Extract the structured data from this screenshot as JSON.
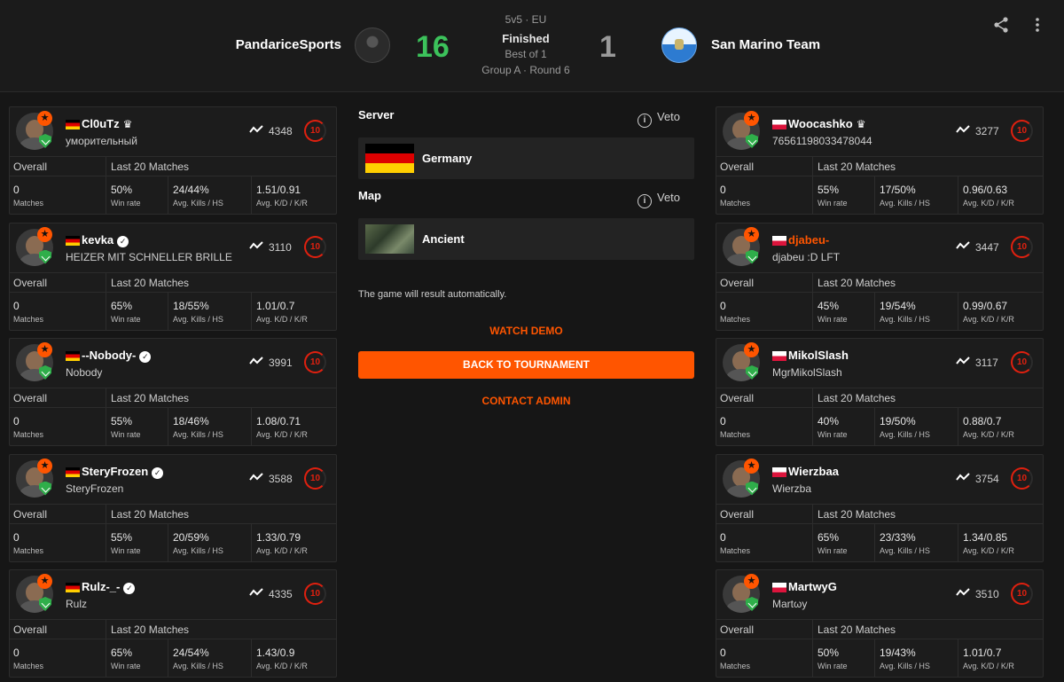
{
  "header": {
    "format": "5v5 · EU",
    "status": "Finished",
    "best_of": "Best of 1",
    "group": "Group A · Round 6",
    "team_left": {
      "name": "PandariceSports",
      "score": "16"
    },
    "team_right": {
      "name": "San Marino Team",
      "score": "1"
    },
    "icons": {
      "share": "share-icon",
      "more": "more-vertical-icon"
    }
  },
  "stat_labels": {
    "overall": "Overall",
    "last20": "Last 20 Matches",
    "matches": "Matches",
    "win_rate": "Win rate",
    "kills_hs": "Avg. Kills / HS",
    "kd_kr": "Avg. K/D / K/R"
  },
  "left_players": [
    {
      "nick": "Cl0uTz",
      "sub": "уморительный",
      "flag": "de",
      "elo": "4348",
      "level": "10",
      "badge": "crown",
      "matches": "0",
      "win_rate": "50%",
      "kills_hs": "24/44%",
      "kd_kr": "1.51/0.91"
    },
    {
      "nick": "kevka",
      "sub": "HEIZER MIT SCHNELLER BRILLE",
      "flag": "de",
      "elo": "3110",
      "level": "10",
      "badge": "verified",
      "matches": "0",
      "win_rate": "65%",
      "kills_hs": "18/55%",
      "kd_kr": "1.01/0.7"
    },
    {
      "nick": "--Nobody-",
      "sub": "Nobody",
      "flag": "de",
      "elo": "3991",
      "level": "10",
      "badge": "verified",
      "matches": "0",
      "win_rate": "55%",
      "kills_hs": "18/46%",
      "kd_kr": "1.08/0.71"
    },
    {
      "nick": "SteryFrozen",
      "sub": "SteryFrozen",
      "flag": "de",
      "elo": "3588",
      "level": "10",
      "badge": "verified",
      "matches": "0",
      "win_rate": "55%",
      "kills_hs": "20/59%",
      "kd_kr": "1.33/0.79"
    },
    {
      "nick": "Rulz-_-",
      "sub": "Rulz",
      "flag": "de",
      "elo": "4335",
      "level": "10",
      "badge": "verified",
      "matches": "0",
      "win_rate": "65%",
      "kills_hs": "24/54%",
      "kd_kr": "1.43/0.9"
    }
  ],
  "right_players": [
    {
      "nick": "Woocashko",
      "sub": "76561198033478044",
      "flag": "pl",
      "elo": "3277",
      "level": "10",
      "badge": "crown",
      "matches": "0",
      "win_rate": "55%",
      "kills_hs": "17/50%",
      "kd_kr": "0.96/0.63"
    },
    {
      "nick": "djabeu-",
      "sub": "djabeu :D LFT",
      "flag": "pl",
      "elo": "3447",
      "level": "10",
      "badge": "none",
      "matches": "0",
      "win_rate": "45%",
      "kills_hs": "19/54%",
      "kd_kr": "0.99/0.67"
    },
    {
      "nick": "MikolSlash",
      "sub": "MgrMikolSlash",
      "flag": "pl",
      "elo": "3117",
      "level": "10",
      "badge": "none",
      "matches": "0",
      "win_rate": "40%",
      "kills_hs": "19/50%",
      "kd_kr": "0.88/0.7"
    },
    {
      "nick": "Wierzbaa",
      "sub": "Wierzba",
      "flag": "pl",
      "elo": "3754",
      "level": "10",
      "badge": "none",
      "matches": "0",
      "win_rate": "65%",
      "kills_hs": "23/33%",
      "kd_kr": "1.34/0.85"
    },
    {
      "nick": "MartwyG",
      "sub": "Martωy",
      "flag": "pl",
      "elo": "3510",
      "level": "10",
      "badge": "none",
      "matches": "0",
      "win_rate": "50%",
      "kills_hs": "19/43%",
      "kd_kr": "1.01/0.7"
    }
  ],
  "center": {
    "server_label": "Server",
    "server_value": "Germany",
    "map_label": "Map",
    "map_value": "Ancient",
    "veto": "Veto",
    "auto_text": "The game will result automatically.",
    "watch_demo": "WATCH DEMO",
    "back_to_tournament": "BACK TO TOURNAMENT",
    "contact_admin": "CONTACT ADMIN"
  },
  "colors": {
    "accent": "#ff5500",
    "win": "#3cc25b",
    "level": "#e0200f"
  }
}
